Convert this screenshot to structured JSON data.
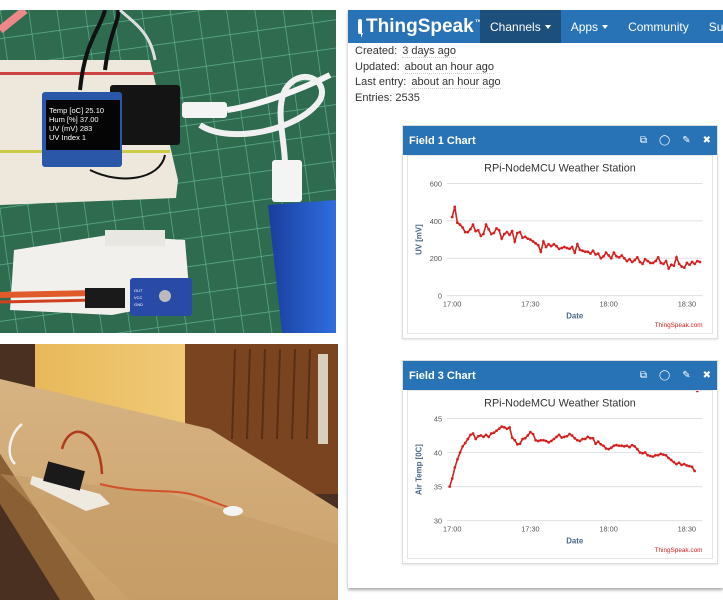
{
  "photos": {
    "top": {
      "description": "Breadboard with OLED display and NodeMCU, UV sensor, USB power bank on green cutting mat",
      "oled_lines": [
        {
          "label": "Temp [oC]",
          "value": "25.10"
        },
        {
          "label": "Hum [%]",
          "value": "37.00"
        },
        {
          "label": "UV (mV)",
          "value": "283"
        },
        {
          "label": "UV Index",
          "value": "1"
        }
      ],
      "sensor_pins": [
        "OUT",
        "VCC",
        "GND"
      ]
    },
    "bottom": {
      "description": "Breadboard setup on wooden board outdoors with wired sensor"
    }
  },
  "thingspeak": {
    "brand": "ThingSpeak",
    "brand_tm": "™",
    "nav": [
      {
        "label": "Channels",
        "dropdown": true,
        "active": true
      },
      {
        "label": "Apps",
        "dropdown": true,
        "active": false
      },
      {
        "label": "Community",
        "dropdown": false,
        "active": false
      },
      {
        "label": "Supp",
        "dropdown": false,
        "active": false
      }
    ],
    "meta": {
      "created_label": "Created:",
      "created_value": "3 days ago",
      "updated_label": "Updated:",
      "updated_value": "about an hour ago",
      "last_entry_label": "Last entry:",
      "last_entry_value": "about an hour ago",
      "entries_label": "Entries:",
      "entries_value": "2535"
    },
    "card_icons": [
      "external-link-icon",
      "comment-icon",
      "pencil-icon",
      "close-icon"
    ],
    "card_icon_glyphs": [
      "⧉",
      "◯",
      "✎",
      "✖"
    ],
    "colors": {
      "navbar": "#2873b6",
      "nav_active": "#1d4f7d",
      "series": "#d62020",
      "watermark": "#d62020"
    }
  },
  "chart_data": [
    {
      "type": "line",
      "panel_title": "Field 1 Chart",
      "title": "RPi-NodeMCU Weather Station",
      "xlabel": "Date",
      "ylabel": "UV [mV]",
      "ylim": [
        0,
        600
      ],
      "yticks": [
        0,
        200,
        400,
        600
      ],
      "xlim_minutes": [
        -2,
        96
      ],
      "xticks": [
        {
          "label": "17:00",
          "min": 0
        },
        {
          "label": "17:30",
          "min": 30
        },
        {
          "label": "18:00",
          "min": 60
        },
        {
          "label": "18:30",
          "min": 90
        }
      ],
      "grid": true,
      "watermark": "ThingSpeak.com",
      "series": [
        {
          "name": "UV [mV]",
          "x_minutes": [
            0,
            1,
            2,
            3,
            4,
            5,
            6,
            7,
            8,
            9,
            10,
            11,
            12,
            13,
            14,
            15,
            16,
            17,
            18,
            19,
            20,
            21,
            22,
            23,
            24,
            25,
            26,
            27,
            28,
            29,
            30,
            31,
            32,
            33,
            34,
            35,
            36,
            37,
            38,
            39,
            40,
            41,
            42,
            43,
            44,
            45,
            46,
            47,
            48,
            49,
            50,
            51,
            52,
            53,
            54,
            55,
            56,
            57,
            58,
            59,
            60,
            61,
            62,
            63,
            64,
            65,
            66,
            67,
            68,
            69,
            70,
            71,
            72,
            73,
            74,
            75,
            76,
            77,
            78,
            79,
            80,
            81,
            82,
            83,
            84,
            85,
            86,
            87,
            88,
            89,
            90,
            91,
            92,
            93,
            94,
            95
          ],
          "values": [
            420,
            475,
            390,
            380,
            365,
            340,
            340,
            355,
            380,
            345,
            350,
            320,
            330,
            380,
            355,
            330,
            335,
            360,
            350,
            305,
            330,
            340,
            325,
            345,
            290,
            335,
            340,
            310,
            315,
            305,
            300,
            290,
            280,
            270,
            235,
            290,
            260,
            275,
            265,
            275,
            265,
            250,
            255,
            260,
            255,
            250,
            260,
            230,
            275,
            245,
            240,
            235,
            235,
            225,
            240,
            220,
            225,
            200,
            210,
            230,
            215,
            200,
            230,
            210,
            205,
            215,
            200,
            185,
            195,
            180,
            190,
            205,
            180,
            170,
            195,
            185,
            175,
            175,
            185,
            205,
            175,
            170,
            185,
            145,
            165,
            160,
            205,
            170,
            155,
            150,
            175,
            165,
            180,
            170,
            185,
            180
          ]
        }
      ]
    },
    {
      "type": "line",
      "panel_title": "Field 3 Chart",
      "title": "RPi-NodeMCU Weather Station",
      "xlabel": "Date",
      "ylabel": "Air Temp [0C]",
      "ylim": [
        30,
        45
      ],
      "yticks": [
        30,
        35,
        40,
        45
      ],
      "xlim_minutes": [
        -2,
        96
      ],
      "xticks": [
        {
          "label": "17:00",
          "min": 0
        },
        {
          "label": "17:30",
          "min": 30
        },
        {
          "label": "18:00",
          "min": 60
        },
        {
          "label": "18:30",
          "min": 90
        }
      ],
      "grid": true,
      "watermark": "ThingSpeak.com",
      "series": [
        {
          "name": "Air Temp [0C]",
          "x_minutes": [
            -1,
            0,
            1,
            2,
            3,
            4,
            5,
            6,
            7,
            8,
            9,
            10,
            11,
            12,
            13,
            14,
            15,
            16,
            17,
            18,
            19,
            20,
            21,
            22,
            23,
            24,
            25,
            26,
            27,
            28,
            29,
            30,
            31,
            32,
            33,
            34,
            35,
            36,
            37,
            38,
            39,
            40,
            41,
            42,
            43,
            44,
            45,
            46,
            47,
            48,
            49,
            50,
            51,
            52,
            53,
            54,
            55,
            56,
            57,
            58,
            59,
            60,
            61,
            62,
            63,
            64,
            65,
            66,
            67,
            68,
            69,
            70,
            71,
            72,
            73,
            74,
            75,
            76,
            77,
            78,
            79,
            80,
            81,
            82,
            83,
            84,
            85,
            86,
            87,
            88,
            89,
            90,
            91,
            92,
            93,
            94
          ],
          "values": [
            35.0,
            36.2,
            37.8,
            39.0,
            40.0,
            40.9,
            41.4,
            42.0,
            42.6,
            42.8,
            42.0,
            42.4,
            42.5,
            42.3,
            42.6,
            42.3,
            42.8,
            42.9,
            43.2,
            43.5,
            43.8,
            43.7,
            43.5,
            43.7,
            42.2,
            41.8,
            41.2,
            41.3,
            42.0,
            42.1,
            42.5,
            43.0,
            42.7,
            41.8,
            41.7,
            41.8,
            41.8,
            41.7,
            41.5,
            41.7,
            42.0,
            42.3,
            42.6,
            42.2,
            42.3,
            42.4,
            42.7,
            42.5,
            42.1,
            41.8,
            41.7,
            42.0,
            42.0,
            42.3,
            42.1,
            42.1,
            41.3,
            41.6,
            41.2,
            41.0,
            40.6,
            40.5,
            40.7,
            41.0,
            41.1,
            41.0,
            41.0,
            40.9,
            41.0,
            40.8,
            41.1,
            40.9,
            40.5,
            40.0,
            39.9,
            40.0,
            39.6,
            39.5,
            39.4,
            39.6,
            39.6,
            39.8,
            39.7,
            39.6,
            39.2,
            38.9,
            38.6,
            38.3,
            38.5,
            38.2,
            38.3,
            38.1,
            38.0,
            37.9,
            37.3
          ]
        }
      ]
    }
  ]
}
